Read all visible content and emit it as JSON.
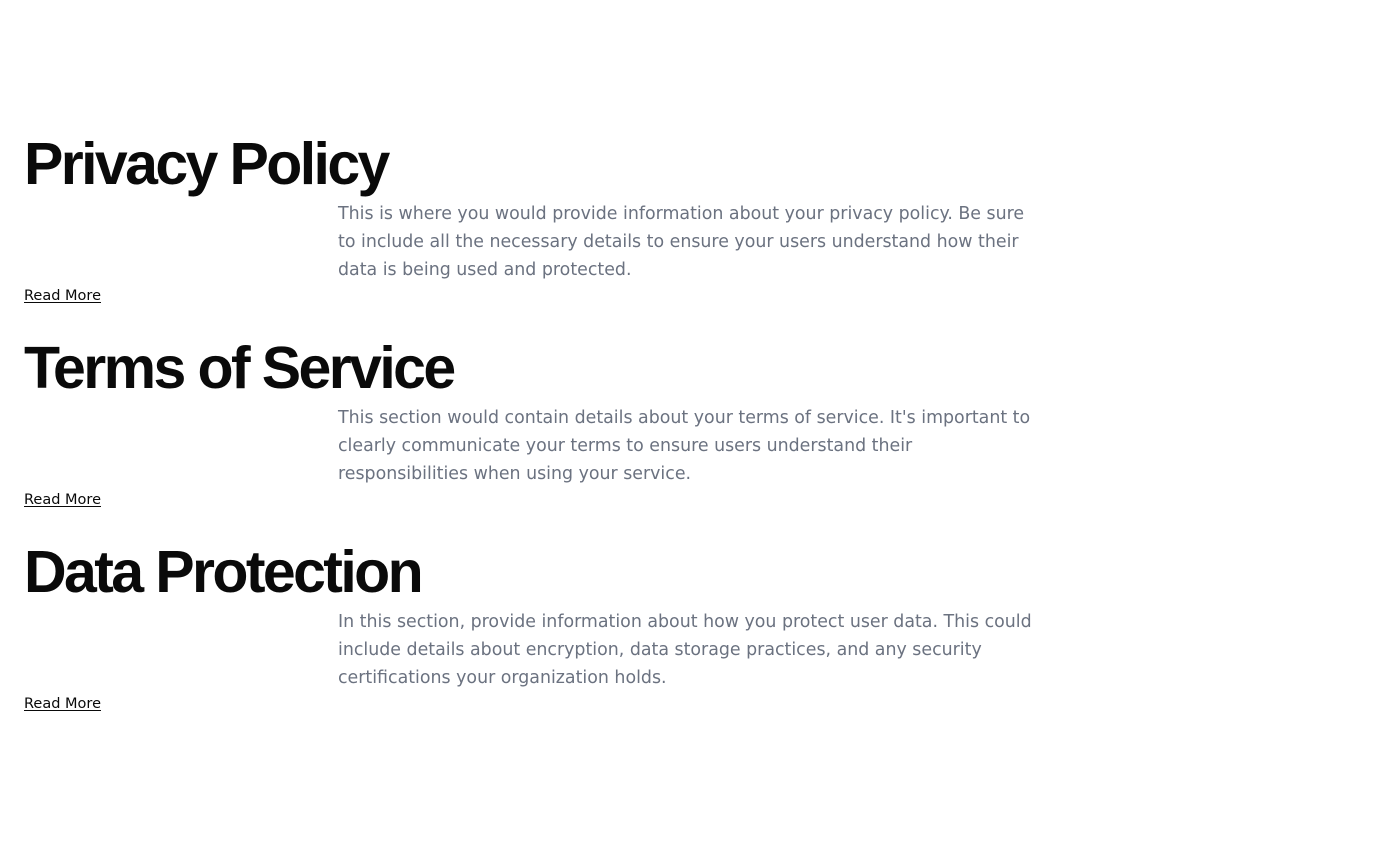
{
  "sections": [
    {
      "title": "Privacy Policy",
      "body": "This is where you would provide information about your privacy policy. Be sure to include all the necessary details to ensure your users understand how their data is being used and protected.",
      "link_label": "Read More"
    },
    {
      "title": "Terms of Service",
      "body": "This section would contain details about your terms of service. It's important to clearly communicate your terms to ensure users understand their responsibilities when using your service.",
      "link_label": "Read More"
    },
    {
      "title": "Data Protection",
      "body": "In this section, provide information about how you protect user data. This could include details about encryption, data storage practices, and any security certifications your organization holds.",
      "link_label": "Read More"
    }
  ],
  "colors": {
    "heading": "#0a0a0a",
    "body_text": "#6b7280",
    "link": "#0a0a0a",
    "background": "#ffffff"
  }
}
